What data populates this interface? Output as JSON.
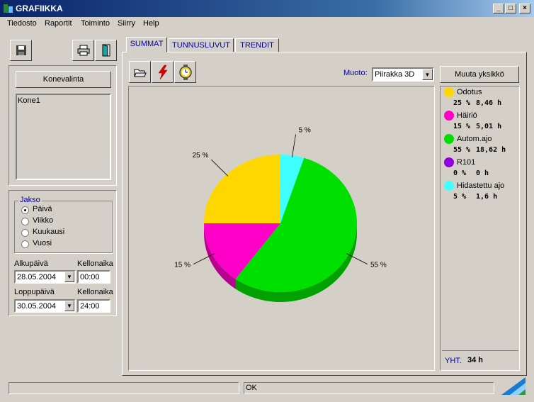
{
  "window": {
    "title": "GRAFIIKKA",
    "min": "_",
    "max": "□",
    "close": "×"
  },
  "menu": [
    "Tiedosto",
    "Raportit",
    "Toiminto",
    "Siirry",
    "Help"
  ],
  "left": {
    "machine_button": "Konevalinta",
    "machines": [
      "Kone1"
    ],
    "period": {
      "legend": "Jakso",
      "options": [
        "Päivä",
        "Viikko",
        "Kuukausi",
        "Vuosi"
      ],
      "selected": "Päivä"
    },
    "start_date_label": "Alkupäivä",
    "start_time_label": "Kellonaika",
    "start_date": "28.05.2004",
    "start_time": "00:00",
    "end_date_label": "Loppupäivä",
    "end_time_label": "Kellonaika",
    "end_date": "30.05.2004",
    "end_time": "24:00"
  },
  "tabs": [
    "SUMMAT",
    "TUNNUSLUVUT",
    "TRENDIT"
  ],
  "active_tab": "SUMMAT",
  "chart_toolbar": {
    "shape_label": "Muoto:",
    "shape_value": "Piirakka 3D",
    "change_unit_button": "Muuta yksikkö"
  },
  "legend": {
    "items": [
      {
        "name": "Odotus",
        "percent": "25 %",
        "hours": "8,46 h",
        "color": "#ffd700"
      },
      {
        "name": "Häiriö",
        "percent": "15 %",
        "hours": "5,01 h",
        "color": "#ff00c8"
      },
      {
        "name": "Autom.ajo",
        "percent": "55 %",
        "hours": "18,62 h",
        "color": "#00e000"
      },
      {
        "name": "R101",
        "percent": "0 %",
        "hours": "0 h",
        "color": "#9000e0"
      },
      {
        "name": "Hidastettu ajo",
        "percent": "5 %",
        "hours": "1,6 h",
        "color": "#40ffff"
      }
    ],
    "total_label": "YHT.",
    "total_value": "34 h"
  },
  "chart_data": {
    "type": "pie",
    "title": "",
    "categories": [
      "Odotus",
      "Häiriö",
      "Autom.ajo",
      "R101",
      "Hidastettu ajo"
    ],
    "values": [
      25,
      15,
      55,
      0,
      5
    ],
    "hours": [
      8.46,
      5.01,
      18.62,
      0,
      1.6
    ],
    "labels": [
      "25 %",
      "15 %",
      "55 %",
      "",
      "5 %"
    ],
    "colors": [
      "#ffd700",
      "#ff00c8",
      "#00e000",
      "#9000e0",
      "#40ffff"
    ],
    "style": "3D"
  },
  "status": {
    "left": "",
    "middle": "OK"
  },
  "icons": [
    "save-icon",
    "print-icon",
    "exit-door-icon",
    "open-folder-icon",
    "lightning-icon",
    "stopwatch-icon",
    "logo-icon"
  ]
}
